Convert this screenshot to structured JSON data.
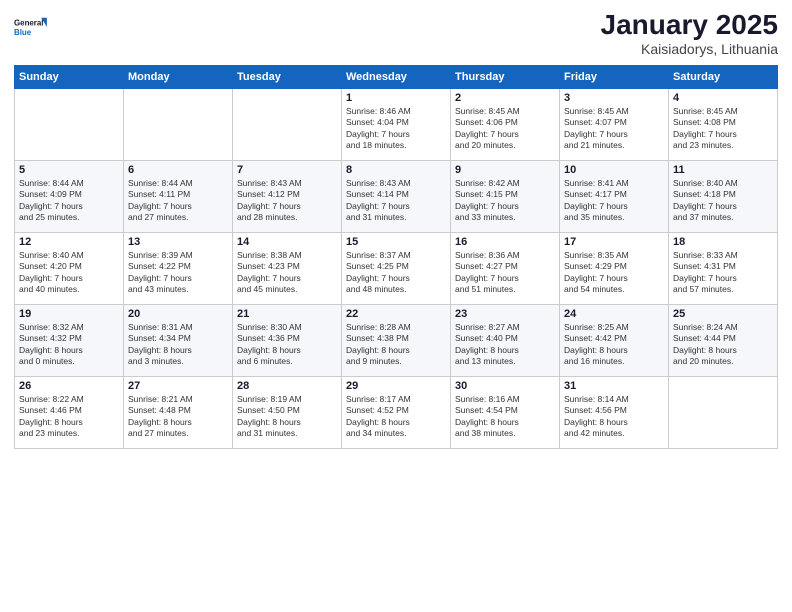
{
  "logo": {
    "line1": "General",
    "line2": "Blue"
  },
  "title": "January 2025",
  "location": "Kaisiadorys, Lithuania",
  "days_header": [
    "Sunday",
    "Monday",
    "Tuesday",
    "Wednesday",
    "Thursday",
    "Friday",
    "Saturday"
  ],
  "weeks": [
    [
      {
        "day": "",
        "info": ""
      },
      {
        "day": "",
        "info": ""
      },
      {
        "day": "",
        "info": ""
      },
      {
        "day": "1",
        "info": "Sunrise: 8:46 AM\nSunset: 4:04 PM\nDaylight: 7 hours\nand 18 minutes."
      },
      {
        "day": "2",
        "info": "Sunrise: 8:45 AM\nSunset: 4:06 PM\nDaylight: 7 hours\nand 20 minutes."
      },
      {
        "day": "3",
        "info": "Sunrise: 8:45 AM\nSunset: 4:07 PM\nDaylight: 7 hours\nand 21 minutes."
      },
      {
        "day": "4",
        "info": "Sunrise: 8:45 AM\nSunset: 4:08 PM\nDaylight: 7 hours\nand 23 minutes."
      }
    ],
    [
      {
        "day": "5",
        "info": "Sunrise: 8:44 AM\nSunset: 4:09 PM\nDaylight: 7 hours\nand 25 minutes."
      },
      {
        "day": "6",
        "info": "Sunrise: 8:44 AM\nSunset: 4:11 PM\nDaylight: 7 hours\nand 27 minutes."
      },
      {
        "day": "7",
        "info": "Sunrise: 8:43 AM\nSunset: 4:12 PM\nDaylight: 7 hours\nand 28 minutes."
      },
      {
        "day": "8",
        "info": "Sunrise: 8:43 AM\nSunset: 4:14 PM\nDaylight: 7 hours\nand 31 minutes."
      },
      {
        "day": "9",
        "info": "Sunrise: 8:42 AM\nSunset: 4:15 PM\nDaylight: 7 hours\nand 33 minutes."
      },
      {
        "day": "10",
        "info": "Sunrise: 8:41 AM\nSunset: 4:17 PM\nDaylight: 7 hours\nand 35 minutes."
      },
      {
        "day": "11",
        "info": "Sunrise: 8:40 AM\nSunset: 4:18 PM\nDaylight: 7 hours\nand 37 minutes."
      }
    ],
    [
      {
        "day": "12",
        "info": "Sunrise: 8:40 AM\nSunset: 4:20 PM\nDaylight: 7 hours\nand 40 minutes."
      },
      {
        "day": "13",
        "info": "Sunrise: 8:39 AM\nSunset: 4:22 PM\nDaylight: 7 hours\nand 43 minutes."
      },
      {
        "day": "14",
        "info": "Sunrise: 8:38 AM\nSunset: 4:23 PM\nDaylight: 7 hours\nand 45 minutes."
      },
      {
        "day": "15",
        "info": "Sunrise: 8:37 AM\nSunset: 4:25 PM\nDaylight: 7 hours\nand 48 minutes."
      },
      {
        "day": "16",
        "info": "Sunrise: 8:36 AM\nSunset: 4:27 PM\nDaylight: 7 hours\nand 51 minutes."
      },
      {
        "day": "17",
        "info": "Sunrise: 8:35 AM\nSunset: 4:29 PM\nDaylight: 7 hours\nand 54 minutes."
      },
      {
        "day": "18",
        "info": "Sunrise: 8:33 AM\nSunset: 4:31 PM\nDaylight: 7 hours\nand 57 minutes."
      }
    ],
    [
      {
        "day": "19",
        "info": "Sunrise: 8:32 AM\nSunset: 4:32 PM\nDaylight: 8 hours\nand 0 minutes."
      },
      {
        "day": "20",
        "info": "Sunrise: 8:31 AM\nSunset: 4:34 PM\nDaylight: 8 hours\nand 3 minutes."
      },
      {
        "day": "21",
        "info": "Sunrise: 8:30 AM\nSunset: 4:36 PM\nDaylight: 8 hours\nand 6 minutes."
      },
      {
        "day": "22",
        "info": "Sunrise: 8:28 AM\nSunset: 4:38 PM\nDaylight: 8 hours\nand 9 minutes."
      },
      {
        "day": "23",
        "info": "Sunrise: 8:27 AM\nSunset: 4:40 PM\nDaylight: 8 hours\nand 13 minutes."
      },
      {
        "day": "24",
        "info": "Sunrise: 8:25 AM\nSunset: 4:42 PM\nDaylight: 8 hours\nand 16 minutes."
      },
      {
        "day": "25",
        "info": "Sunrise: 8:24 AM\nSunset: 4:44 PM\nDaylight: 8 hours\nand 20 minutes."
      }
    ],
    [
      {
        "day": "26",
        "info": "Sunrise: 8:22 AM\nSunset: 4:46 PM\nDaylight: 8 hours\nand 23 minutes."
      },
      {
        "day": "27",
        "info": "Sunrise: 8:21 AM\nSunset: 4:48 PM\nDaylight: 8 hours\nand 27 minutes."
      },
      {
        "day": "28",
        "info": "Sunrise: 8:19 AM\nSunset: 4:50 PM\nDaylight: 8 hours\nand 31 minutes."
      },
      {
        "day": "29",
        "info": "Sunrise: 8:17 AM\nSunset: 4:52 PM\nDaylight: 8 hours\nand 34 minutes."
      },
      {
        "day": "30",
        "info": "Sunrise: 8:16 AM\nSunset: 4:54 PM\nDaylight: 8 hours\nand 38 minutes."
      },
      {
        "day": "31",
        "info": "Sunrise: 8:14 AM\nSunset: 4:56 PM\nDaylight: 8 hours\nand 42 minutes."
      },
      {
        "day": "",
        "info": ""
      }
    ]
  ]
}
